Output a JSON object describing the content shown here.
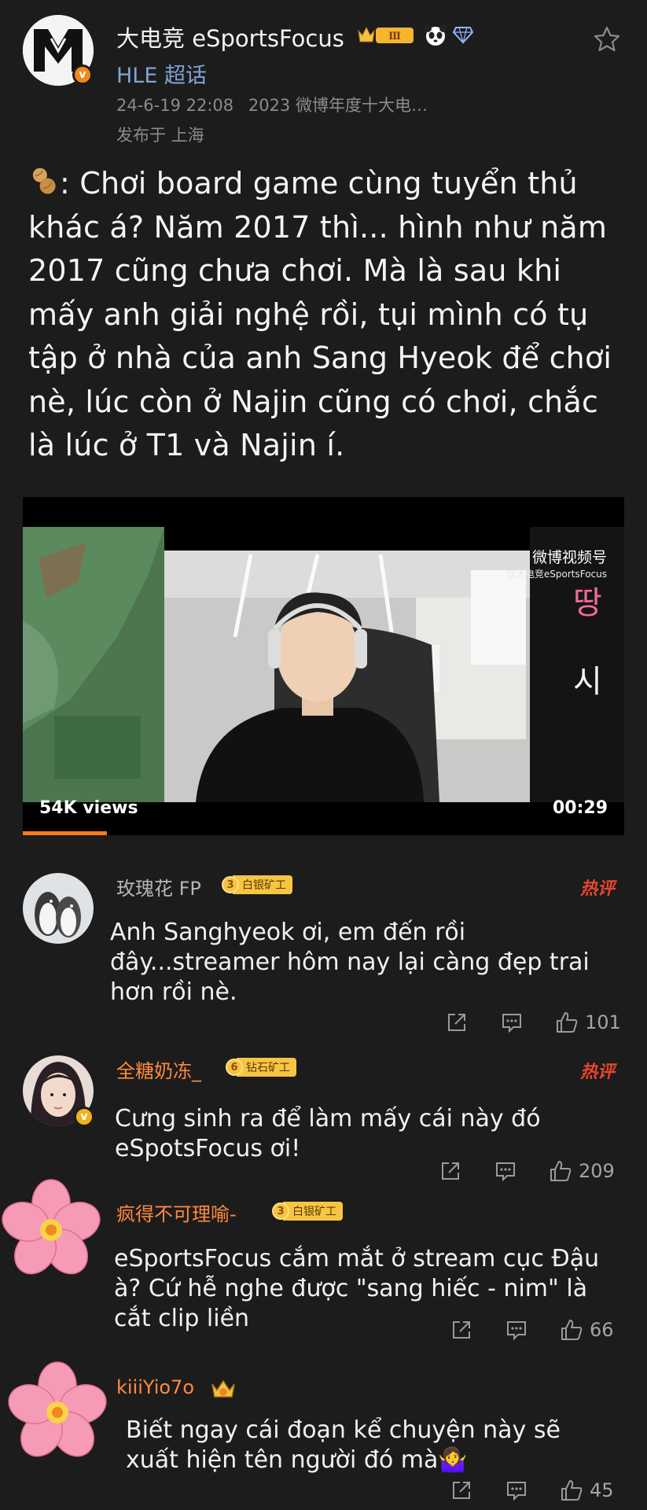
{
  "post": {
    "author": "大电竞 eSportsFocus",
    "topic": "HLE 超话",
    "timestamp": "24-6-19 22:08",
    "source": "2023 微博年度十大电…",
    "location": "发布于 上海",
    "crown_level": "Ⅲ",
    "text": ": Chơi board game cùng tuyển thủ khác á? Năm 2017 thì... hình như năm 2017 cũng chưa chơi. Mà là sau khi mấy anh giải nghệ rồi, tụi mình có tụ tập ở nhà của anh Sang Hyeok để chơi nè, lúc còn ở Najin cũng có chơi, chắc là lúc ở T1 và Najin í."
  },
  "video": {
    "views": "54K views",
    "duration": "00:29",
    "watermark_title": "微博视频号",
    "watermark_handle": "@大电竞eSportsFocus",
    "progress_fraction": 0.14
  },
  "comments": [
    {
      "name": "玫瑰花 FP",
      "level": "3",
      "level_text": "白银矿工",
      "hot": "热评",
      "text": "Anh Sanghyeok ơi, em đến rồi đây...streamer hôm nay lại càng đẹp trai hơn rồi nè.",
      "likes": "101"
    },
    {
      "name": "全糖奶冻_",
      "level": "6",
      "level_text": "钻石矿工",
      "hot": "热评",
      "text": "Cưng sinh ra để làm mấy cái này đó eSpotsFocus ơi!",
      "likes": "209"
    },
    {
      "name": "疯得不可理喻-",
      "level": "3",
      "level_text": "白银矿工",
      "text": "eSportsFocus cắm mắt ở stream cục Đậu à? Cứ hễ nghe được \"sang hiếc - nim\" là cắt clip liền",
      "likes": "66"
    },
    {
      "name": "kiiiYio7o",
      "text": "Biết ngay cái đoạn kể chuyện này sẽ xuất hiện tên người đó mà🤷‍♀️",
      "likes": "45"
    }
  ],
  "colors": {
    "background": "#1c1c1c",
    "topic_blue": "#7fa3d6",
    "orange_name": "#ff8a3d",
    "hot_red": "#e8452d",
    "progress": "#ff7a1a"
  }
}
